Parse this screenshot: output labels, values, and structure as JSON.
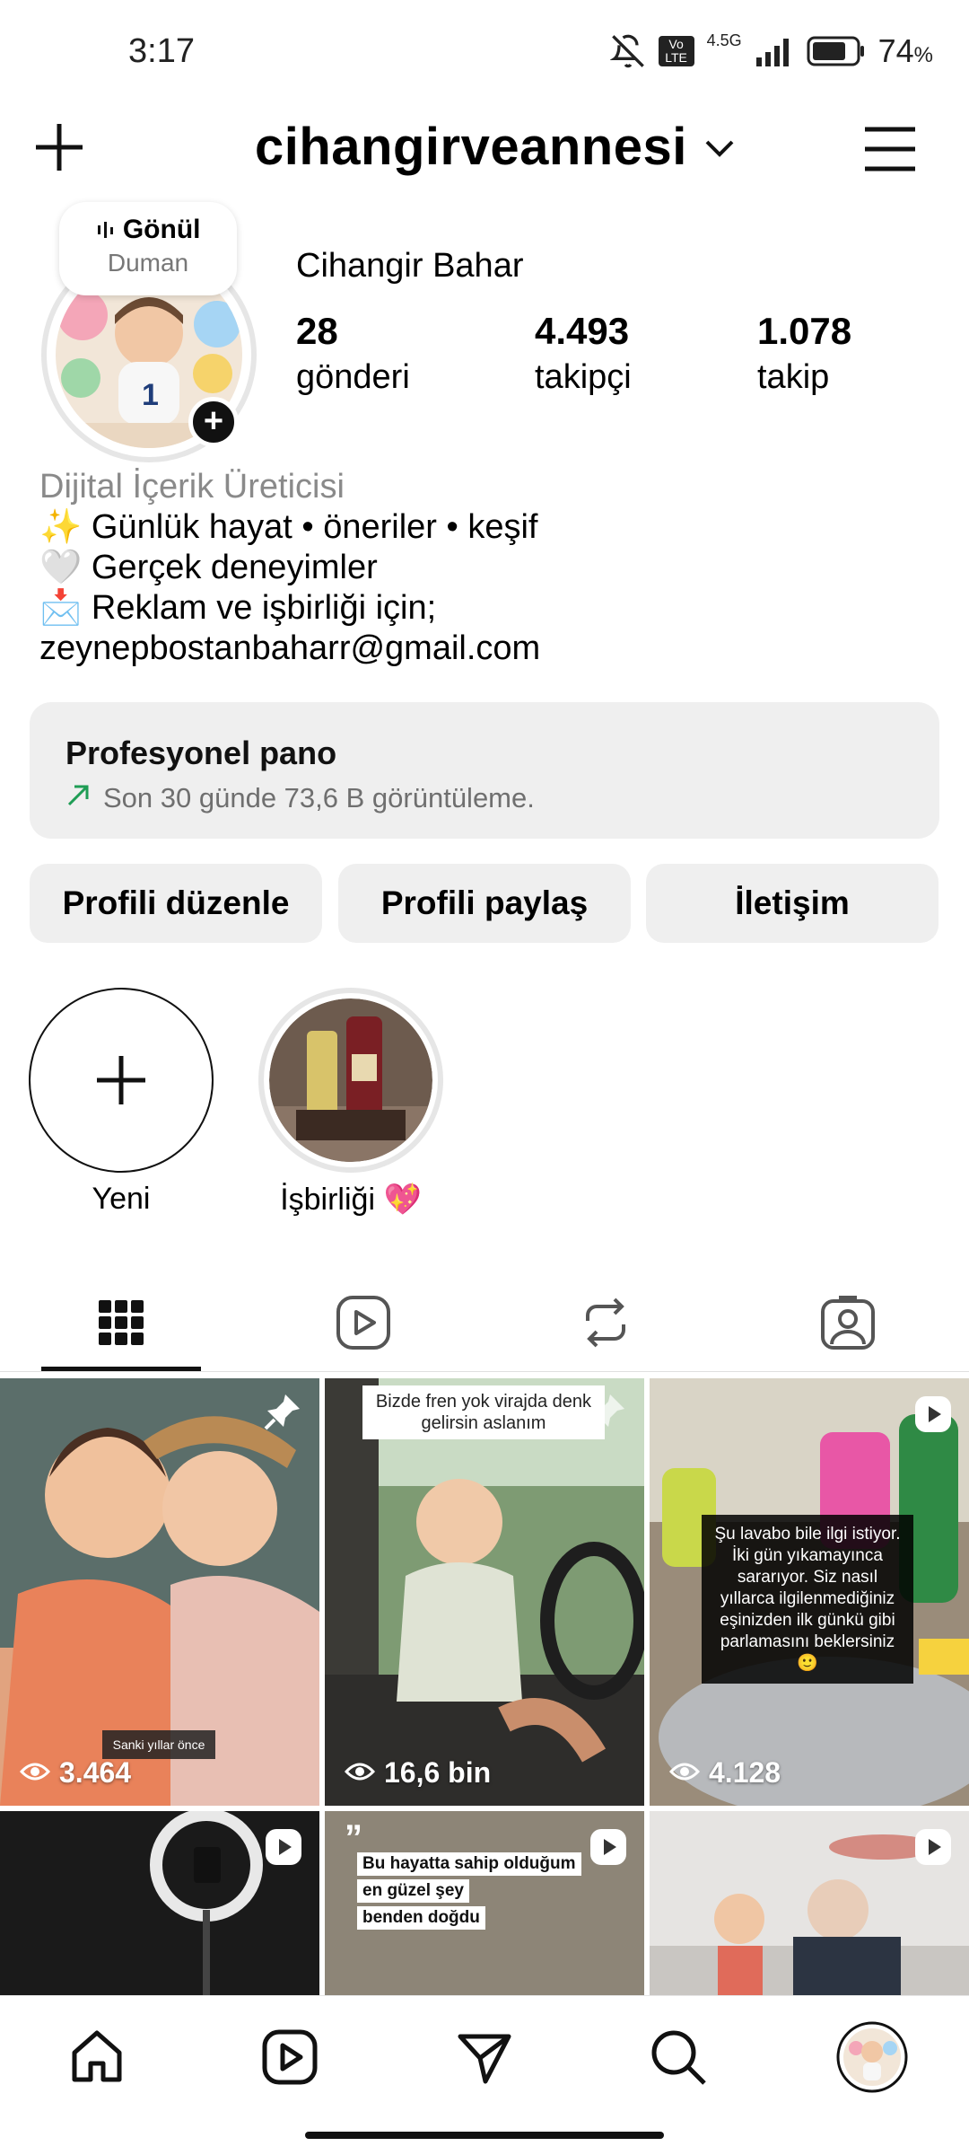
{
  "status": {
    "time": "3:17",
    "network": "4.5G",
    "lte": "Vo LTE",
    "battery": "74",
    "battery_unit": "%"
  },
  "header": {
    "username": "cihangirveannesi"
  },
  "note": {
    "title": "Gönül",
    "subtitle": "Duman"
  },
  "profile": {
    "full_name": "Cihangir Bahar",
    "stats": [
      {
        "value": "28",
        "label": "gönderi"
      },
      {
        "value": "4.493",
        "label": "takipçi"
      },
      {
        "value": "1.078",
        "label": "takip"
      }
    ],
    "bio_category": "Dijital İçerik Üreticisi",
    "bio_lines": [
      "✨ Günlük hayat • öneriler • keşif",
      "🤍 Gerçek deneyimler",
      "📩 Reklam ve işbirliği için;",
      "zeynepbostanbaharr@gmail.com"
    ]
  },
  "dashboard": {
    "title": "Profesyonel pano",
    "subtitle": "Son 30 günde 73,6 B görüntüleme."
  },
  "buttons": {
    "edit": "Profili düzenle",
    "share": "Profili paylaş",
    "contact": "İletişim"
  },
  "highlights": [
    {
      "label": "Yeni"
    },
    {
      "label": "İşbirliği 💖"
    }
  ],
  "posts": [
    {
      "views": "3.464",
      "caption": "Sanki yıllar önce",
      "pinned": true
    },
    {
      "views": "16,6 bin",
      "caption": "Bizde fren yok virajda denk gelirsin aslanım",
      "pinned": true
    },
    {
      "views": "4.128",
      "caption": "Şu lavabo bile ilgi istiyor. İki gün yıkamayınca sararıyor. Siz nasıl yıllarca ilgilenmediğiniz eşinizden ilk günkü gibi parlamasını beklersiniz 🙂",
      "reel": true
    },
    {
      "reel": true
    },
    {
      "caption_lines": [
        "Bu hayatta sahip olduğum",
        "en güzel şey",
        "benden doğdu"
      ],
      "reel": true
    },
    {
      "reel": true
    }
  ],
  "colors": {
    "accent": "#000000",
    "card_bg": "#efefef",
    "muted": "#8a8a8a",
    "trend_green": "#1f9d55"
  }
}
